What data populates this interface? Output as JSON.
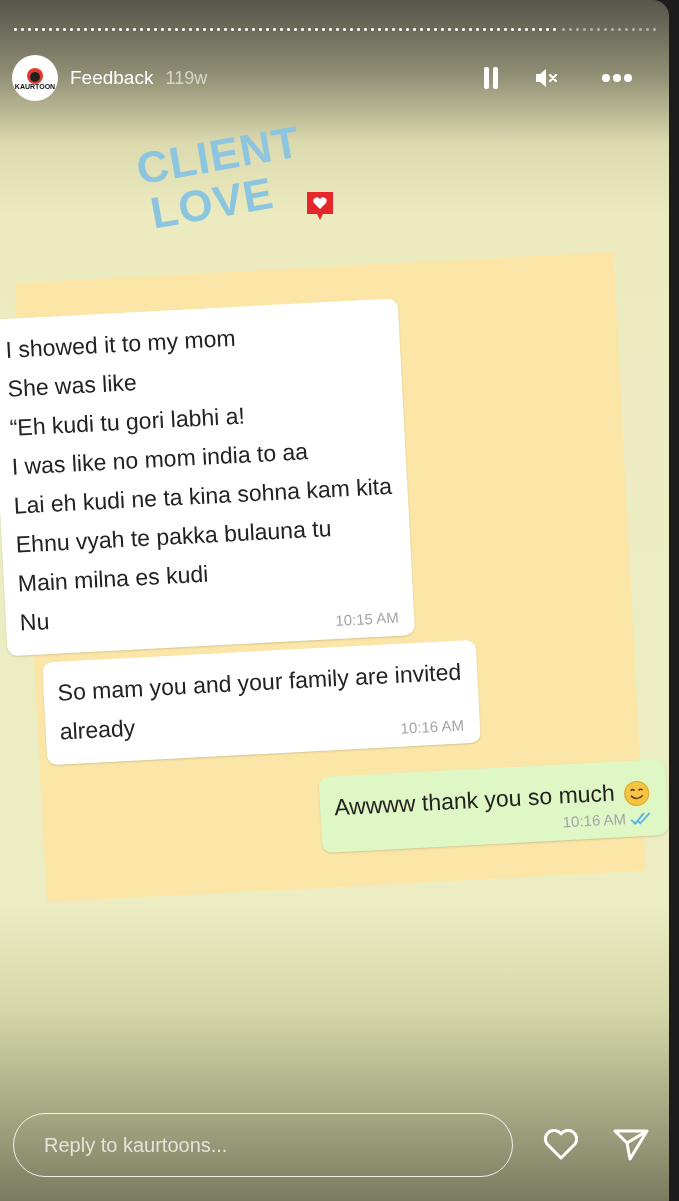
{
  "story": {
    "progress": {
      "level": 0.85
    },
    "account": {
      "avatar_text": "KAURTOON",
      "title": "Feedback",
      "age": "119w"
    },
    "controls": {
      "paused": false,
      "muted": true
    }
  },
  "image": {
    "heading": [
      "CLIENT",
      "LOVE"
    ],
    "messages": [
      {
        "kind": "received",
        "text": "I showed it to my mom\nShe was like\n“Eh kudi tu gori labhi a!\nI was like no mom india to aa\nLai eh kudi ne ta kina sohna kam kita\nEhnu vyah te pakka bulauna tu\nMain milna es kudi\nNu",
        "time": "10:15 AM"
      },
      {
        "kind": "received",
        "text": "So mam you and your family are invited\nalready",
        "time": "10:16 AM"
      },
      {
        "kind": "sent",
        "text": "Awwww thank you so much",
        "time": "10:16 AM",
        "read": true
      }
    ]
  },
  "reply": {
    "placeholder": "Reply to kaurtoons...",
    "liked": false
  }
}
